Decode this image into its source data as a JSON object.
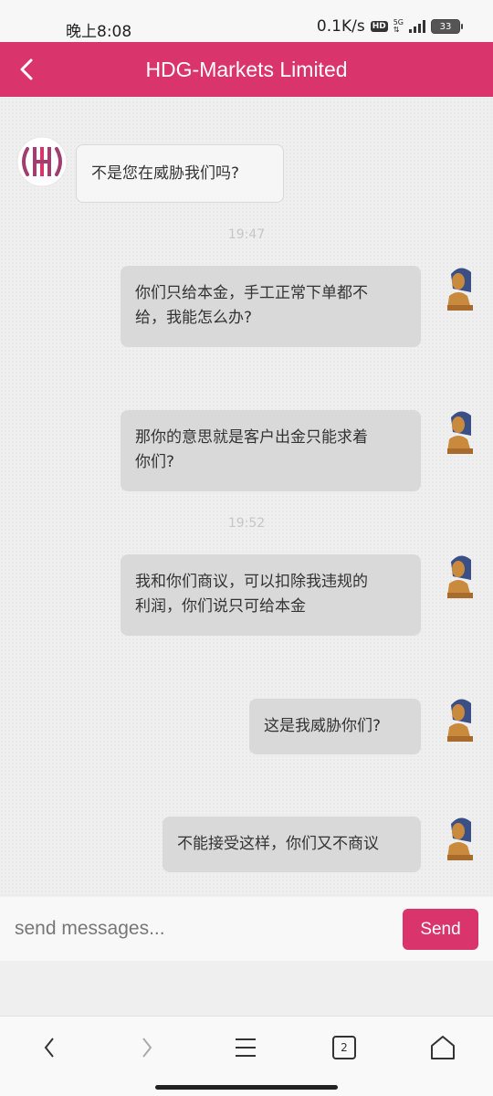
{
  "status_bar": {
    "time": "晚上8:08",
    "net_speed": "0.1K/s",
    "hd_badge": "HD",
    "network": "5G",
    "battery": "33"
  },
  "header": {
    "title": "HDG-Markets Limited",
    "color": "#d9346c"
  },
  "messages": [
    {
      "side": "left",
      "text_lines": [
        "不是您在威胁我们吗?"
      ]
    },
    {
      "type": "timestamp",
      "text": "19:47"
    },
    {
      "side": "right",
      "text_lines": [
        "你们只给本金，手工正常下单都不",
        "给，我能怎么办?"
      ]
    },
    {
      "side": "right",
      "text_lines": [
        "那你的意思就是客户出金只能求着",
        "你们?"
      ]
    },
    {
      "type": "timestamp",
      "text": "19:52"
    },
    {
      "side": "right",
      "text_lines": [
        "我和你们商议，可以扣除我违规的",
        "利润，你们说只可给本金"
      ]
    },
    {
      "side": "right",
      "text_lines": [
        "这是我威胁你们?"
      ]
    },
    {
      "side": "right",
      "text_lines": [
        "不能接受这样，你们又不商议"
      ]
    }
  ],
  "input": {
    "placeholder": "send messages...",
    "value": "",
    "send_label": "Send"
  },
  "bottom_nav": {
    "tab_count": "2",
    "icons": [
      "back-icon",
      "forward-icon",
      "menu-icon",
      "tabs-icon",
      "home-icon"
    ]
  }
}
